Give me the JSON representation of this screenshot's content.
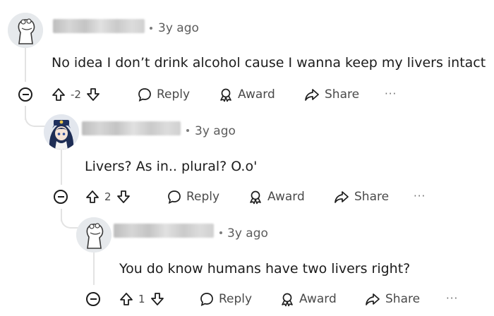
{
  "comments": [
    {
      "time": "3y ago",
      "text": "No idea I don’t drink alcohol cause I wanna keep my livers intact",
      "votes": "-2",
      "reply_label": "Reply",
      "award_label": "Award",
      "share_label": "Share",
      "more_label": "···"
    },
    {
      "time": "3y ago",
      "text": "Livers? As in.. plural? O.o'",
      "votes": "2",
      "reply_label": "Reply",
      "award_label": "Award",
      "share_label": "Share",
      "more_label": "···"
    },
    {
      "time": "3y ago",
      "text": "You do know humans have two livers right?",
      "votes": "1",
      "reply_label": "Reply",
      "award_label": "Award",
      "share_label": "Share",
      "more_label": "···"
    }
  ]
}
